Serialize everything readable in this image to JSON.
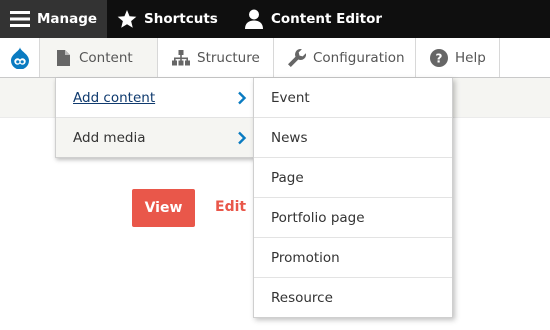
{
  "toolbar": {
    "manage_label": "Manage",
    "shortcuts_label": "Shortcuts",
    "user_label": "Content Editor"
  },
  "tray": {
    "items": [
      {
        "label": "Content",
        "icon": "file-icon"
      },
      {
        "label": "Structure",
        "icon": "sitemap-icon"
      },
      {
        "label": "Configuration",
        "icon": "wrench-icon"
      },
      {
        "label": "Help",
        "icon": "help-icon"
      }
    ]
  },
  "content_menu": {
    "items": [
      {
        "label": "Add content"
      },
      {
        "label": "Add media"
      }
    ]
  },
  "add_content_menu": {
    "items": [
      {
        "label": "Event"
      },
      {
        "label": "News"
      },
      {
        "label": "Page"
      },
      {
        "label": "Portfolio page"
      },
      {
        "label": "Promotion"
      },
      {
        "label": "Resource"
      }
    ]
  },
  "page": {
    "view_label": "View",
    "edit_label": "Edit"
  },
  "colors": {
    "toolbar_bg": "#0f0f0f",
    "accent_red": "#e9574a",
    "drupal_blue": "#0a7bc1",
    "link_blue": "#0f3a6e"
  }
}
